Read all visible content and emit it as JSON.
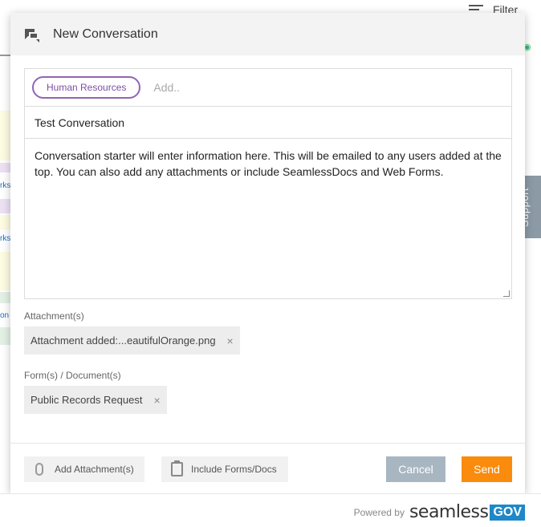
{
  "background": {
    "filter_label": "Filter",
    "left_labels": [
      "rks",
      "rks",
      "on T"
    ]
  },
  "support_tab": {
    "label": "Support"
  },
  "modal": {
    "title": "New Conversation",
    "recipients": {
      "chip": "Human Resources",
      "placeholder": "Add.."
    },
    "subject": "Test Conversation",
    "message": "Conversation starter will enter information here. This will be emailed to any users added at the top. You can also add any attachments or include SeamlessDocs and Web Forms.",
    "attachments": {
      "label": "Attachment(s)",
      "items": [
        "Attachment added:...eautifulOrange.png"
      ]
    },
    "forms": {
      "label": "Form(s) / Document(s)",
      "items": [
        "Public Records Request"
      ]
    },
    "remove_glyph": "×",
    "buttons": {
      "add_attachment": "Add Attachment(s)",
      "include_forms": "Include Forms/Docs",
      "cancel": "Cancel",
      "send": "Send"
    }
  },
  "footer": {
    "powered_by": "Powered by",
    "brand": "seamless",
    "brand_suffix": "GOV"
  },
  "colors": {
    "chip_border": "#9065b5",
    "send": "#fa8b0c",
    "cancel": "#a8b6c2",
    "support": "#8c9aa6",
    "brand_gov": "#1e88c8"
  }
}
